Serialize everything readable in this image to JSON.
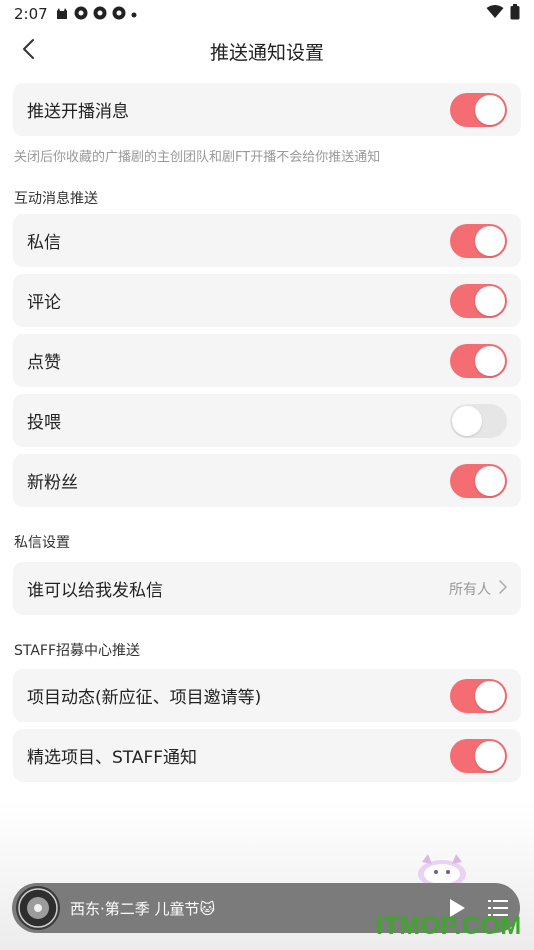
{
  "status_bar": {
    "time": "2:07",
    "icons": [
      "cat-icon",
      "camera-shutter-icon",
      "camera-shutter-icon",
      "camera-shutter-icon",
      "dot-icon"
    ],
    "right_icons": [
      "wifi-icon",
      "battery-icon"
    ]
  },
  "header": {
    "title": "推送通知设置",
    "back_icon": "chevron-left-icon"
  },
  "live_push": {
    "label": "推送开播消息",
    "enabled": true,
    "hint": "关闭后你收藏的广播剧的主创团队和剧FT开播不会给你推送通知"
  },
  "interaction": {
    "section_title": "互动消息推送",
    "items": [
      {
        "label": "私信",
        "enabled": true
      },
      {
        "label": "评论",
        "enabled": true
      },
      {
        "label": "点赞",
        "enabled": true
      },
      {
        "label": "投喂",
        "enabled": false
      },
      {
        "label": "新粉丝",
        "enabled": true
      }
    ]
  },
  "dm_settings": {
    "section_title": "私信设置",
    "row_label": "谁可以给我发私信",
    "row_value": "所有人"
  },
  "staff": {
    "section_title": "STAFF招募中心推送",
    "items": [
      {
        "label": "项目动态(新应征、项目邀请等)",
        "enabled": true
      },
      {
        "label": "精选项目、STAFF通知",
        "enabled": true
      }
    ]
  },
  "player": {
    "title": "西东·第二季 儿童节",
    "emoji": "🐱"
  },
  "watermark": "ITMOP.COM",
  "colors": {
    "toggle_on": "#f36d73",
    "toggle_off": "#e6e6e6",
    "card_bg": "#f5f5f5",
    "watermark": "#3fa72c"
  }
}
